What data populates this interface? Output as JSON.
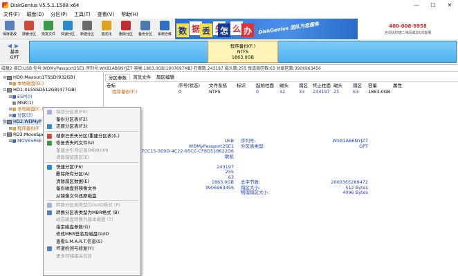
{
  "window": {
    "title": "DiskGenius V5.5.1.1508 x64",
    "controls": [
      "—",
      "☐",
      "✕"
    ]
  },
  "menu": [
    "文件(F)",
    "磁盘(D)",
    "分区(P)",
    "工具(T)",
    "查看(V)",
    "帮助(H)"
  ],
  "toolbar": [
    {
      "label": "保存更改",
      "color": "#5a7fc0"
    },
    {
      "label": "搜索分区",
      "color": "#d04a3a"
    },
    {
      "label": "恢复文件",
      "color": "#3a9a4a"
    },
    {
      "label": "快速分区",
      "color": "#2a8ad0"
    },
    {
      "label": "新建分区",
      "color": "#6a6a6a"
    },
    {
      "label": "格式化",
      "color": "#e0a020"
    },
    {
      "label": "删除分区",
      "color": "#c03030"
    },
    {
      "label": "备份分区",
      "color": "#4a7ab0"
    },
    {
      "label": "系统迁移",
      "color": "#3070c0"
    }
  ],
  "banner": {
    "chars": [
      {
        "c": "数",
        "bg": "#f8e040",
        "fg": "#1a3a9a"
      },
      {
        "c": "据",
        "bg": "#ffffff",
        "fg": "#e03030"
      },
      {
        "c": "丢",
        "bg": "#f8e040",
        "fg": "#1a3a9a"
      },
      {
        "c": "失",
        "bg": "#ffffff",
        "fg": "#e03030"
      },
      {
        "c": "怎",
        "bg": "#1a3a9a",
        "fg": "#ffffff"
      },
      {
        "c": "么",
        "bg": "#ffffff",
        "fg": "#e03030"
      },
      {
        "c": "办",
        "bg": "#e03030",
        "fg": "#ffffff"
      }
    ],
    "slogan": "DiskGenius 团队为您服务",
    "phone": "400-008-9958",
    "qq": "咨询请扫描二维码或加QQ客服"
  },
  "disk_panel": {
    "nav": [
      "基本",
      "GPT"
    ],
    "partition": {
      "name": "程序备份(F:)",
      "fs": "NTFS",
      "size": "1863.0GB"
    }
  },
  "info_bar": "磁盘2 接口:USB  型号:WDMyPassport25E1  序列号:WX81AB6NYJZ7  容量:1863.0GB(1907697MB)  柱面数:243197  磁头数:255  每道扇区数:63  总扇区数:3906963456",
  "tree": [
    {
      "text": "HD0:Maxsun1TSSD(932GB)",
      "level": 0,
      "type": "disk",
      "expand": "⊟"
    },
    {
      "text": "本地磁盘(D:)",
      "level": 1,
      "type": "part",
      "color": "orange",
      "expand": "⊞"
    },
    {
      "text": "HD1:X15SSD512GB(477GB)",
      "level": 0,
      "type": "disk",
      "expand": "⊟"
    },
    {
      "text": "ESP(0)",
      "level": 1,
      "type": "part",
      "color": "blue",
      "expand": "⊞"
    },
    {
      "text": "MSR(1)",
      "level": 1,
      "type": "part",
      "color": "black",
      "expand": ""
    },
    {
      "text": "本地磁盘(C:)",
      "level": 1,
      "type": "part",
      "color": "orange",
      "expand": "⊞"
    },
    {
      "text": "分区(3)",
      "level": 1,
      "type": "part",
      "color": "blue",
      "expand": "⊞"
    },
    {
      "text": "HD2:WDMyP",
      "level": 0,
      "type": "disk",
      "expand": "⊟",
      "selected": true
    },
    {
      "text": "程序备份(F",
      "level": 1,
      "type": "part",
      "color": "orange",
      "expand": "⊞"
    },
    {
      "text": "RD3:MoveSpe",
      "level": 0,
      "type": "disk",
      "expand": "⊟"
    },
    {
      "text": "MOVESPEE",
      "level": 1,
      "type": "part",
      "color": "blue",
      "expand": "⊞"
    }
  ],
  "tabs": [
    "分区参数",
    "浏览文件",
    "扇区编辑"
  ],
  "table": {
    "headers": [
      "卷标",
      "序号(状态)",
      "文件系统",
      "标识",
      "起始柱面",
      "磁头",
      "扇区",
      "终止柱面",
      "磁头",
      "扇区",
      "容量",
      "属性"
    ],
    "row": [
      "程序备份(F:)",
      "0",
      "NTFS",
      "",
      "0",
      "32",
      "33",
      "243197",
      "25",
      "63",
      "1863.0GB",
      ""
    ]
  },
  "details_left": [
    "USB",
    "WDMyPassport25E1",
    "50B7CC15-3E9D-4C22-95CC-CF8D518622D6",
    "联机",
    "",
    "243197",
    "255",
    "63",
    "1863.0GB",
    "3906963456"
  ],
  "details_mid": [
    "序列号:",
    "分区表类型:",
    "",
    "",
    "",
    "",
    "",
    "",
    "总字节数:",
    "扇区大小:",
    "物理扇区大小:"
  ],
  "details_right": [
    "WX81AB6NYJZ7",
    "GPT",
    "",
    "",
    "",
    "",
    "",
    "",
    "2000365289472",
    "512 Bytes",
    "4096 Bytes"
  ],
  "context_menu": [
    {
      "label": "保存分区表(F8)",
      "disabled": true,
      "icon": "#9fb4d8"
    },
    {
      "label": "备份分区表(F2)",
      "disabled": false,
      "icon": ""
    },
    {
      "label": "还原分区表(F3)",
      "disabled": false,
      "icon": "#3a8ad0"
    },
    {
      "sep": true
    },
    {
      "label": "搜索已丢失分区(重建分区表)(L)",
      "disabled": false,
      "icon": "#d04a3a"
    },
    {
      "label": "恢复丢失的文件(U)",
      "disabled": false,
      "icon": "#3a9a4a"
    },
    {
      "label": "重建主引导记录(MBR)(M)",
      "disabled": true,
      "icon": ""
    },
    {
      "label": "清除保留扇区(E)",
      "disabled": true,
      "icon": ""
    },
    {
      "sep": true
    },
    {
      "label": "快速分区(F6)",
      "disabled": false,
      "icon": "#2a8ad0"
    },
    {
      "label": "删除所有分区(A)",
      "disabled": false,
      "icon": ""
    },
    {
      "label": "清除扇区数据(E)",
      "disabled": false,
      "icon": ""
    },
    {
      "label": "备份磁盘到镜像文件",
      "disabled": false,
      "icon": ""
    },
    {
      "label": "从镜像文件还原磁盘",
      "disabled": false,
      "icon": ""
    },
    {
      "sep": true
    },
    {
      "label": "转换分区表类型为GUID格式 (P)",
      "disabled": true,
      "icon": "#9fb4d8"
    },
    {
      "label": "转换分区表类型为MBR格式 (B)",
      "disabled": false,
      "icon": "#5a7fc0"
    },
    {
      "label": "动态磁盘转换为基本磁盘 (T)",
      "disabled": true,
      "icon": ""
    },
    {
      "label": "指定磁盘参数(G)",
      "disabled": false,
      "icon": ""
    },
    {
      "label": "修改MBR签名及磁盘GUID",
      "disabled": false,
      "icon": ""
    },
    {
      "label": "查看S.M.A.R.T.信息(S)",
      "disabled": false,
      "icon": ""
    },
    {
      "label": "坏道检测与修复(Y)",
      "disabled": false,
      "icon": "#5a7fc0"
    },
    {
      "label": "更多存储相关信息",
      "disabled": true,
      "icon": ""
    }
  ]
}
